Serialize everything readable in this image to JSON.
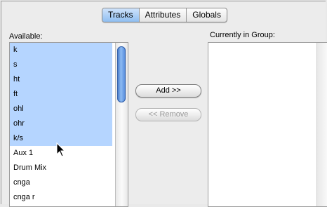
{
  "tabs": [
    {
      "label": "Tracks",
      "active": true
    },
    {
      "label": "Attributes",
      "active": false
    },
    {
      "label": "Globals",
      "active": false
    }
  ],
  "available": {
    "label": "Available:",
    "items": [
      {
        "label": "k",
        "selected": true
      },
      {
        "label": "s",
        "selected": true
      },
      {
        "label": "ht",
        "selected": true
      },
      {
        "label": "ft",
        "selected": true
      },
      {
        "label": "ohl",
        "selected": true
      },
      {
        "label": "ohr",
        "selected": true
      },
      {
        "label": "k/s",
        "selected": true
      },
      {
        "label": "Aux 1",
        "selected": false
      },
      {
        "label": "Drum Mix",
        "selected": false
      },
      {
        "label": "cnga",
        "selected": false
      },
      {
        "label": "cnga r",
        "selected": false
      }
    ]
  },
  "group": {
    "label": "Currently in Group:",
    "items": []
  },
  "buttons": {
    "add_label": "Add >>",
    "remove_label": "<< Remove"
  },
  "colors": {
    "selection": "#b5d5ff",
    "active_tab": "#8fbef1"
  }
}
